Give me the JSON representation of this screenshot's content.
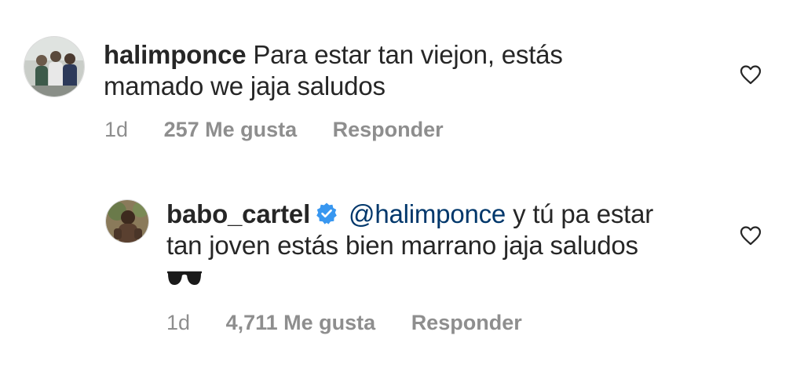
{
  "comments": [
    {
      "username": "halimponce",
      "text_line1": "Para estar tan viejon, estás",
      "text_line2": "mamado we jaja saludos",
      "time": "1d",
      "likes": "257 Me gusta",
      "reply": "Responder",
      "like_icon": "heart-outline-icon"
    },
    {
      "username": "babo_cartel",
      "verified": true,
      "mention": "@halimponce",
      "text_line1_rest": "y tú pa estar",
      "text_line2": "tan joven estás bien marrano jaja saludos",
      "emoji": "sunglasses-emoji",
      "time": "1d",
      "likes": "4,711 Me gusta",
      "reply": "Responder",
      "like_icon": "heart-outline-icon"
    }
  ],
  "colors": {
    "text": "#262626",
    "secondary": "#8e8e8e",
    "mention": "#00376b",
    "verified": "#3897f0"
  }
}
